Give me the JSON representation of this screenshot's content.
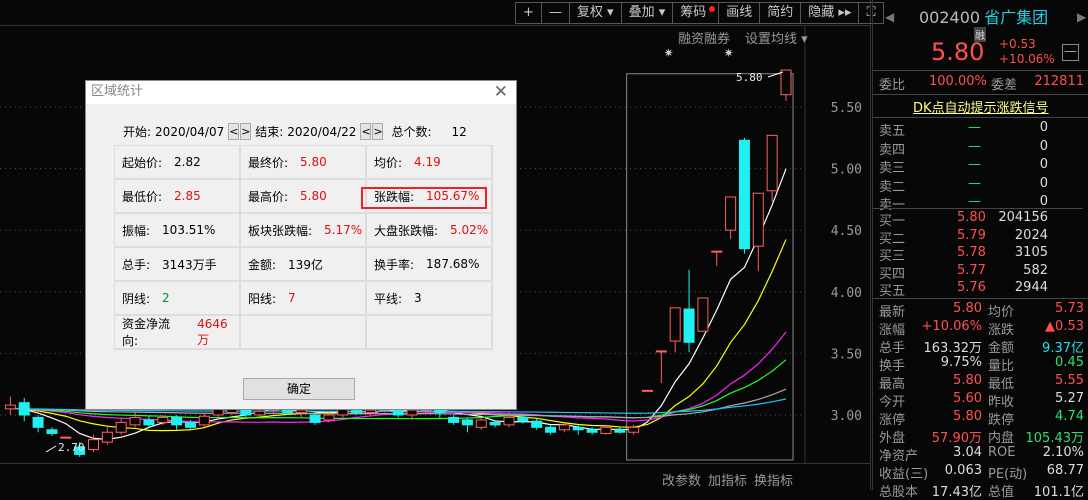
{
  "toolbar": {
    "items": [
      "+",
      "—",
      "复权 ▾",
      "叠加 ▾",
      "筹码",
      "画线",
      "简约",
      "隐藏 ▸▸",
      "⛶"
    ]
  },
  "chart_header": {
    "margin": "融资融券",
    "ma_setting": "设置均线 ▾"
  },
  "chart_footer": {
    "items": [
      "改参数",
      "加指标",
      "换指标"
    ]
  },
  "axis": {
    "ticks": [
      "5.50",
      "5.00",
      "4.50",
      "4.00",
      "3.50",
      "3.00"
    ]
  },
  "annotations": {
    "high_label": "5.80",
    "low_label": "2.70"
  },
  "colors": {
    "up": "#ff6060",
    "down": "#20f0f0",
    "ma": [
      "#ffffff",
      "#ffff00",
      "#ff20ff",
      "#20ff20",
      "#aaaaaa",
      "#20c0ff"
    ]
  },
  "kline": {
    "price_range": [
      2.62,
      5.85
    ],
    "candles": [
      [
        3.05,
        3.08,
        3.15,
        3.0
      ],
      [
        3.1,
        3.0,
        3.14,
        2.95
      ],
      [
        2.98,
        2.9,
        3.0,
        2.86
      ],
      [
        2.88,
        2.85,
        2.9,
        2.83
      ],
      [
        2.82,
        2.82,
        2.82,
        2.82
      ],
      [
        2.74,
        2.68,
        2.78,
        2.66
      ],
      [
        2.72,
        2.8,
        2.84,
        2.7
      ],
      [
        2.78,
        2.86,
        2.9,
        2.76
      ],
      [
        2.86,
        2.94,
        2.98,
        2.84
      ],
      [
        2.92,
        2.98,
        3.02,
        2.9
      ],
      [
        2.96,
        2.92,
        2.99,
        2.9
      ],
      [
        2.94,
        2.98,
        3.0,
        2.92
      ],
      [
        2.98,
        2.92,
        3.0,
        2.88
      ],
      [
        2.94,
        2.9,
        2.96,
        2.88
      ],
      [
        2.92,
        2.99,
        3.02,
        2.9
      ],
      [
        3.0,
        3.05,
        3.08,
        2.98
      ],
      [
        3.02,
        3.06,
        3.08,
        3.0
      ],
      [
        3.04,
        3.0,
        3.06,
        2.98
      ],
      [
        3.0,
        3.03,
        3.05,
        2.98
      ],
      [
        3.04,
        3.1,
        3.12,
        3.0
      ],
      [
        3.08,
        3.02,
        3.1,
        3.0
      ],
      [
        3.02,
        3.04,
        3.06,
        2.98
      ],
      [
        3.0,
        2.94,
        3.02,
        2.92
      ],
      [
        2.96,
        3.0,
        3.02,
        2.94
      ],
      [
        3.0,
        3.06,
        3.08,
        2.98
      ],
      [
        3.06,
        3.02,
        3.1,
        3.0
      ],
      [
        3.02,
        3.04,
        3.06,
        3.0
      ],
      [
        3.04,
        3.08,
        3.1,
        3.02
      ],
      [
        3.06,
        3.0,
        3.08,
        2.98
      ],
      [
        3.0,
        3.04,
        3.06,
        2.96
      ],
      [
        3.04,
        3.1,
        3.12,
        3.02
      ],
      [
        3.08,
        3.02,
        3.1,
        2.98
      ],
      [
        2.98,
        2.94,
        3.0,
        2.92
      ],
      [
        2.96,
        2.92,
        2.98,
        2.86
      ],
      [
        2.9,
        2.96,
        2.98,
        2.88
      ],
      [
        2.94,
        2.92,
        2.96,
        2.9
      ],
      [
        2.92,
        2.98,
        3.02,
        2.9
      ],
      [
        2.98,
        2.95,
        3.0,
        2.93
      ],
      [
        2.95,
        2.9,
        2.97,
        2.88
      ],
      [
        2.9,
        2.86,
        2.92,
        2.84
      ],
      [
        2.88,
        2.92,
        2.94,
        2.86
      ],
      [
        2.9,
        2.88,
        2.92,
        2.84
      ],
      [
        2.88,
        2.86,
        2.9,
        2.84
      ],
      [
        2.85,
        2.9,
        2.92,
        2.84
      ],
      [
        2.88,
        2.86,
        2.9,
        2.85
      ],
      [
        2.86,
        2.9,
        2.92,
        2.84
      ],
      [
        3.2,
        3.2,
        3.2,
        3.2
      ],
      [
        3.52,
        3.52,
        3.52,
        3.26
      ],
      [
        3.6,
        3.87,
        3.87,
        3.51
      ],
      [
        3.86,
        3.59,
        4.18,
        3.51
      ],
      [
        3.68,
        3.95,
        3.95,
        3.68
      ],
      [
        4.33,
        4.33,
        4.33,
        4.21
      ],
      [
        4.5,
        4.77,
        4.77,
        4.43
      ],
      [
        5.23,
        4.35,
        5.25,
        4.31
      ],
      [
        4.37,
        4.8,
        4.8,
        4.17
      ],
      [
        4.82,
        5.27,
        5.27,
        4.73
      ],
      [
        5.6,
        5.8,
        5.8,
        5.55
      ]
    ],
    "selection": {
      "start": "2020/04/07",
      "end": "2020/04/22"
    }
  },
  "dialog": {
    "title": "区域统计",
    "close": "✕",
    "start_label": "开始:",
    "start": "2020/04/07",
    "end_label": "结束:",
    "end": "2020/04/22",
    "count_label": "总个数:",
    "count": "12",
    "prev": "<",
    "next": ">",
    "cells": [
      {
        "label": "起始价:",
        "value": "2.82",
        "color": "black"
      },
      {
        "label": "最终价:",
        "value": "5.80",
        "color": "red"
      },
      {
        "label": "均价:",
        "value": "4.19",
        "color": "red"
      },
      {
        "label": "最低价:",
        "value": "2.85",
        "color": "red"
      },
      {
        "label": "最高价:",
        "value": "5.80",
        "color": "red"
      },
      {
        "label": "张跌幅:",
        "value": "105.67%",
        "color": "red"
      },
      {
        "label": "振幅:",
        "value": "103.51%",
        "color": "black"
      },
      {
        "label": "板块张跌幅:",
        "value": "5.17%",
        "color": "red"
      },
      {
        "label": "大盘张跌幅:",
        "value": "5.02%",
        "color": "red"
      },
      {
        "label": "总手:",
        "value": "3143万手",
        "color": "black"
      },
      {
        "label": "金额:",
        "value": "139亿",
        "color": "black"
      },
      {
        "label": "换手率:",
        "value": "187.68%",
        "color": "black"
      },
      {
        "label": "阴线:",
        "value": "2",
        "color": "green"
      },
      {
        "label": "阳线:",
        "value": "7",
        "color": "red"
      },
      {
        "label": "平线:",
        "value": "3",
        "color": "black"
      },
      {
        "label": "资金净流向:",
        "value": "4646万",
        "color": "red"
      },
      {
        "label": "",
        "value": "",
        "color": "black"
      },
      {
        "label": "",
        "value": "",
        "color": "black"
      }
    ],
    "ok": "确定"
  },
  "quote": {
    "code": "002400",
    "name": "省广集团",
    "rong": "融",
    "price": "5.80",
    "change": "+0.53",
    "pct": "+10.06%",
    "collapse": "—",
    "wb_label": "委比",
    "wb": "100.00%",
    "wc_label": "委差",
    "wc": "212811",
    "dk": "DK点自动提示涨跌信号",
    "sells": [
      {
        "l": "卖五",
        "p": "—",
        "v": "0"
      },
      {
        "l": "卖四",
        "p": "—",
        "v": "0"
      },
      {
        "l": "卖三",
        "p": "—",
        "v": "0"
      },
      {
        "l": "卖二",
        "p": "—",
        "v": "0"
      },
      {
        "l": "卖一",
        "p": "—",
        "v": "0"
      }
    ],
    "buys": [
      {
        "l": "买一",
        "p": "5.80",
        "v": "204156"
      },
      {
        "l": "买二",
        "p": "5.79",
        "v": "2024"
      },
      {
        "l": "买三",
        "p": "5.78",
        "v": "3105"
      },
      {
        "l": "买四",
        "p": "5.77",
        "v": "582"
      },
      {
        "l": "买五",
        "p": "5.76",
        "v": "2944"
      }
    ],
    "stats": [
      [
        "最新",
        "5.80",
        "rd",
        "均价",
        "5.73",
        "rd"
      ],
      [
        "涨幅",
        "+10.06%",
        "rd",
        "涨跌",
        "▲0.53",
        "rd"
      ],
      [
        "总手",
        "163.32万",
        "wh",
        "金额",
        "9.37亿",
        "cy"
      ],
      [
        "换手",
        "9.75%",
        "wh",
        "量比",
        "0.45",
        "gn"
      ],
      [
        "最高",
        "5.80",
        "rd",
        "最低",
        "5.55",
        "rd"
      ],
      [
        "今开",
        "5.60",
        "rd",
        "昨收",
        "5.27",
        "wh"
      ],
      [
        "涨停",
        "5.80",
        "rd",
        "跌停",
        "4.74",
        "gn"
      ],
      [
        "外盘",
        "57.90万",
        "rd",
        "内盘",
        "105.43万",
        "gn"
      ],
      [
        "净资产",
        "3.04",
        "wh",
        "ROE",
        "2.10%",
        "wh"
      ],
      [
        "收益(三)",
        "0.063",
        "wh",
        "PE(动)",
        "68.77",
        "wh"
      ],
      [
        "总股本",
        "17.43亿",
        "wh",
        "总值",
        "101.1亿",
        "wh"
      ]
    ]
  }
}
